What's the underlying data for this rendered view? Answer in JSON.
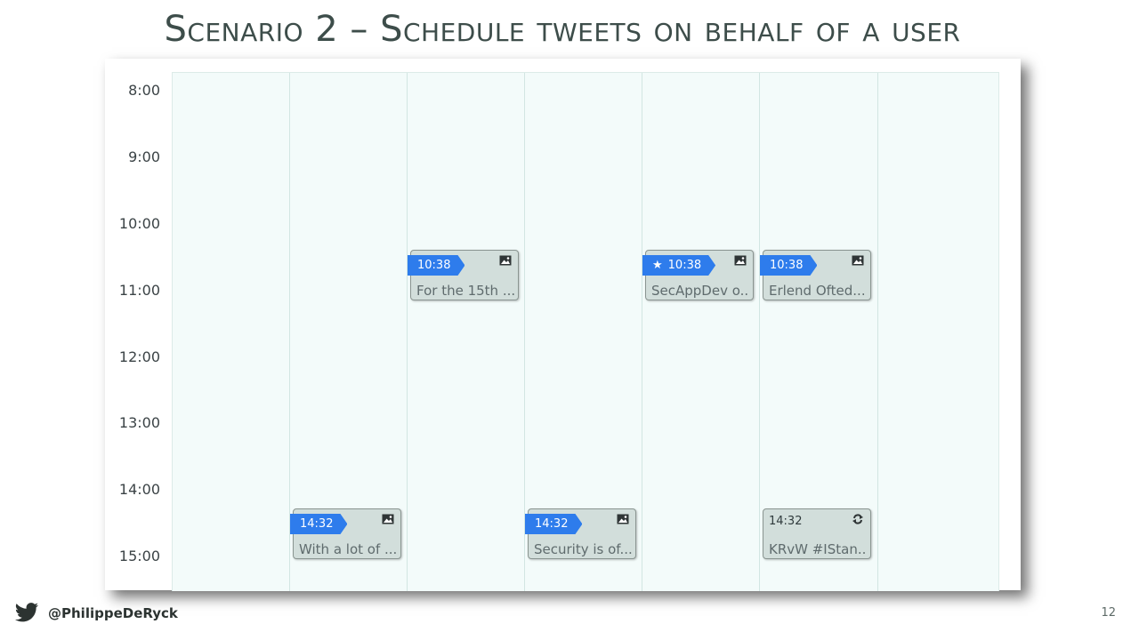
{
  "slide": {
    "title": "Scenario 2 – Schedule tweets on behalf of a user",
    "page_number": "12"
  },
  "footer": {
    "handle": "@PhilippeDeRyck",
    "icon": "twitter-bird-icon"
  },
  "calendar": {
    "time_labels": [
      "8:00",
      "9:00",
      "10:00",
      "11:00",
      "12:00",
      "13:00",
      "14:00",
      "15:00"
    ],
    "colors": {
      "badge": "#2e7cec",
      "card": "#d2dedb",
      "grid": "#f3fbfa"
    },
    "tweets": [
      {
        "time": "10:38",
        "text": "For the 15th ...",
        "icon": "image-icon",
        "starred": false,
        "star": ""
      },
      {
        "time": "10:38",
        "text": "SecAppDev o...",
        "icon": "image-icon",
        "starred": true,
        "star": "★"
      },
      {
        "time": "10:38",
        "text": "Erlend Ofted...",
        "icon": "image-icon",
        "starred": false,
        "star": ""
      },
      {
        "time": "14:32",
        "text": "With a lot of ...",
        "icon": "image-icon",
        "starred": false,
        "star": ""
      },
      {
        "time": "14:32",
        "text": "Security is of...",
        "icon": "image-icon",
        "starred": false,
        "star": ""
      },
      {
        "time": "14:32",
        "text": "KRvW #IStan...",
        "icon": "retweet-icon",
        "starred": false,
        "star": ""
      }
    ]
  }
}
